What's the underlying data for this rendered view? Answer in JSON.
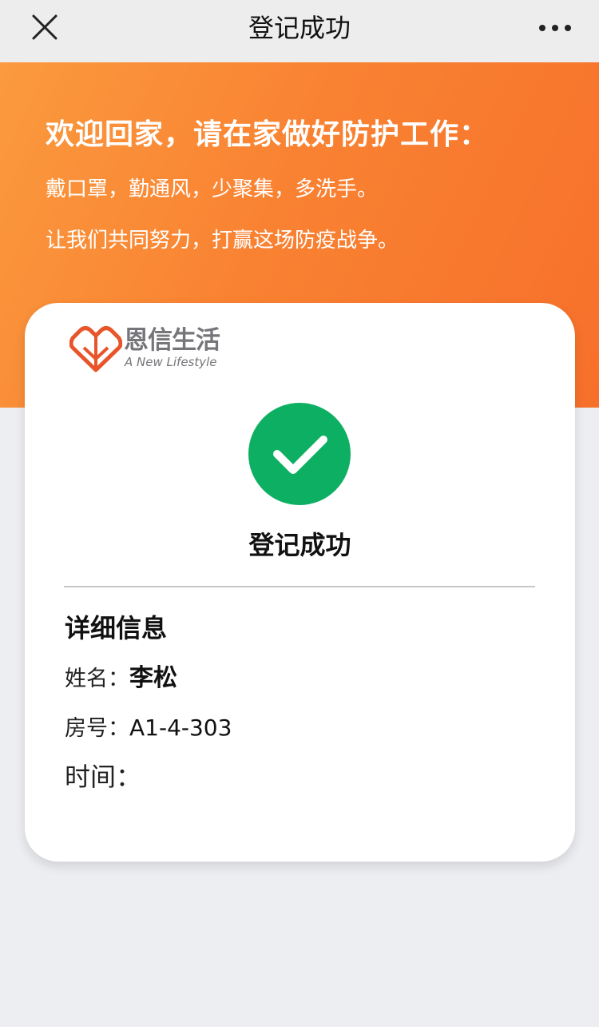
{
  "nav": {
    "title": "登记成功",
    "close_icon": "close-icon",
    "more_icon": "more-horizontal-icon"
  },
  "banner": {
    "headline": "欢迎回家，请在家做好防护工作：",
    "line1": "戴口罩，勤通风，少聚集，多洗手。",
    "line2": "让我们共同努力，打赢这场防疫战争。",
    "gradient_colors": [
      "#fb9a3e",
      "#f7702b"
    ]
  },
  "card": {
    "logo": {
      "cn": "恩信生活",
      "en": "A New Lifestyle",
      "brand_color": "#e8552a"
    },
    "status": {
      "icon": "check-circle-icon",
      "color": "#0daf62",
      "text": "登记成功"
    },
    "details": {
      "title": "详细信息",
      "name_label": "姓名：",
      "name_value": "李松",
      "room_label": "房号：",
      "room_value": "A1-4-303",
      "time_label": "时间：",
      "time_value": ""
    }
  }
}
